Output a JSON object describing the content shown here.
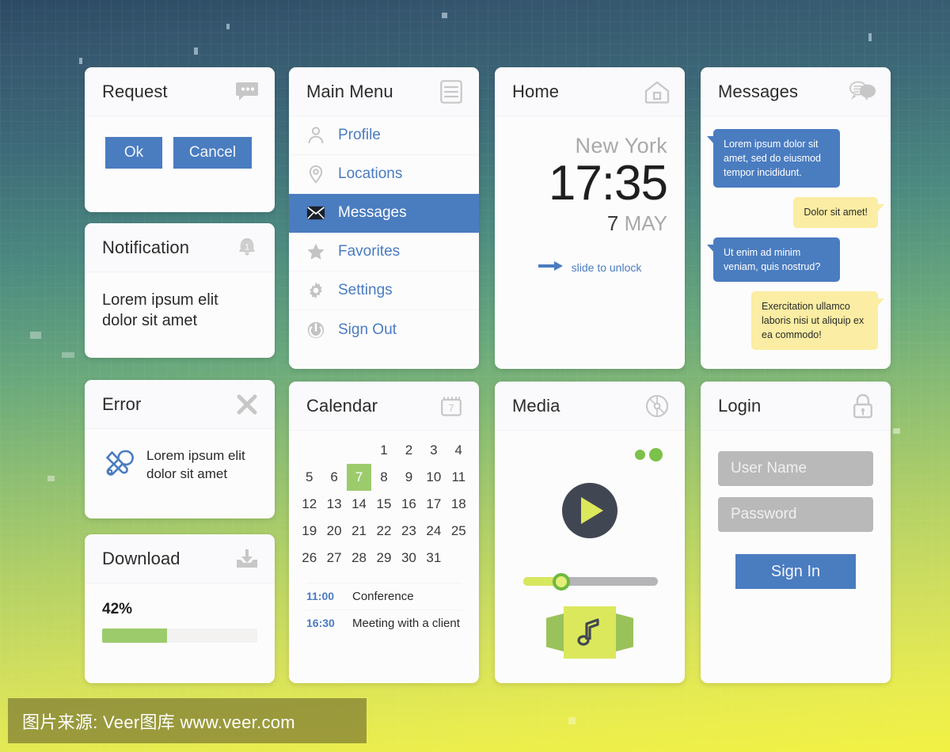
{
  "background": {
    "gradient_top": "#2c4a63",
    "gradient_mid": "#6aa97c",
    "gradient_bottom": "#f2f143"
  },
  "theme": {
    "accent_blue": "#4a7cc0",
    "accent_green": "#9ccb6c",
    "accent_lime": "#dbe85c",
    "bubble_yellow": "#fbeda3",
    "card_bg": "#fdfcfd",
    "icon_grey": "#c7c7c7"
  },
  "cards": {
    "request": {
      "title": "Request",
      "icon": "chat-bubble-dots-icon",
      "ok_label": "Ok",
      "cancel_label": "Cancel"
    },
    "notification": {
      "title": "Notification",
      "icon": "bell-badge-icon",
      "body": "Lorem ipsum elit dolor sit amet"
    },
    "error": {
      "title": "Error",
      "icon": "close-x-icon",
      "tool_icon": "wrench-screwdriver-icon",
      "body": "Lorem ipsum elit dolor sit amet"
    },
    "download": {
      "title": "Download",
      "icon": "download-tray-icon",
      "percent_label": "42%",
      "percent_value": 42
    },
    "menu": {
      "title": "Main Menu",
      "icon": "hamburger-list-icon",
      "items": [
        {
          "label": "Profile",
          "icon": "user-icon",
          "active": false
        },
        {
          "label": "Locations",
          "icon": "map-pin-icon",
          "active": false
        },
        {
          "label": "Messages",
          "icon": "envelope-icon",
          "active": true
        },
        {
          "label": "Favorites",
          "icon": "star-icon",
          "active": false
        },
        {
          "label": "Settings",
          "icon": "gear-icon",
          "active": false
        },
        {
          "label": "Sign Out",
          "icon": "power-off-icon",
          "active": false
        }
      ]
    },
    "home": {
      "title": "Home",
      "icon": "house-icon",
      "city": "New York",
      "time": "17:35",
      "day": "7",
      "month": "MAY",
      "slide_label": "slide to unlock",
      "slide_icon": "arrow-right-icon"
    },
    "messages": {
      "title": "Messages",
      "icon": "two-chat-bubbles-icon",
      "bubbles": [
        {
          "side": "left",
          "text": "Lorem ipsum dolor sit amet, sed do eiusmod tempor incididunt."
        },
        {
          "side": "right",
          "text": "Dolor sit amet!"
        },
        {
          "side": "left",
          "text": "Ut enim ad minim veniam, quis nostrud?"
        },
        {
          "side": "right",
          "text": "Exercitation ullamco laboris nisi ut aliquip ex ea commodo!"
        }
      ]
    },
    "calendar": {
      "title": "Calendar",
      "icon": "calendar-icon",
      "icon_day": "7",
      "leading_blanks": 3,
      "days": [
        1,
        2,
        3,
        4,
        5,
        6,
        7,
        8,
        9,
        10,
        11,
        12,
        13,
        14,
        15,
        16,
        17,
        18,
        19,
        20,
        21,
        22,
        23,
        24,
        25,
        26,
        27,
        28,
        29,
        30,
        31
      ],
      "selected_day": 7,
      "events": [
        {
          "time": "11:00",
          "title": "Conference"
        },
        {
          "time": "16:30",
          "title": "Meeting with a client"
        }
      ]
    },
    "media": {
      "title": "Media",
      "icon": "disc-icon",
      "play_icon": "play-button-icon",
      "slider_percent": 28,
      "album_icon": "music-note-icon",
      "signal_icon": "signal-dots-icon"
    },
    "login": {
      "title": "Login",
      "icon": "padlock-icon",
      "username_placeholder": "User Name",
      "username_value": "",
      "password_placeholder": "Password",
      "password_value": "",
      "signin_label": "Sign In"
    }
  },
  "watermark": {
    "text": "图片来源: Veer图库 www.veer.com"
  }
}
